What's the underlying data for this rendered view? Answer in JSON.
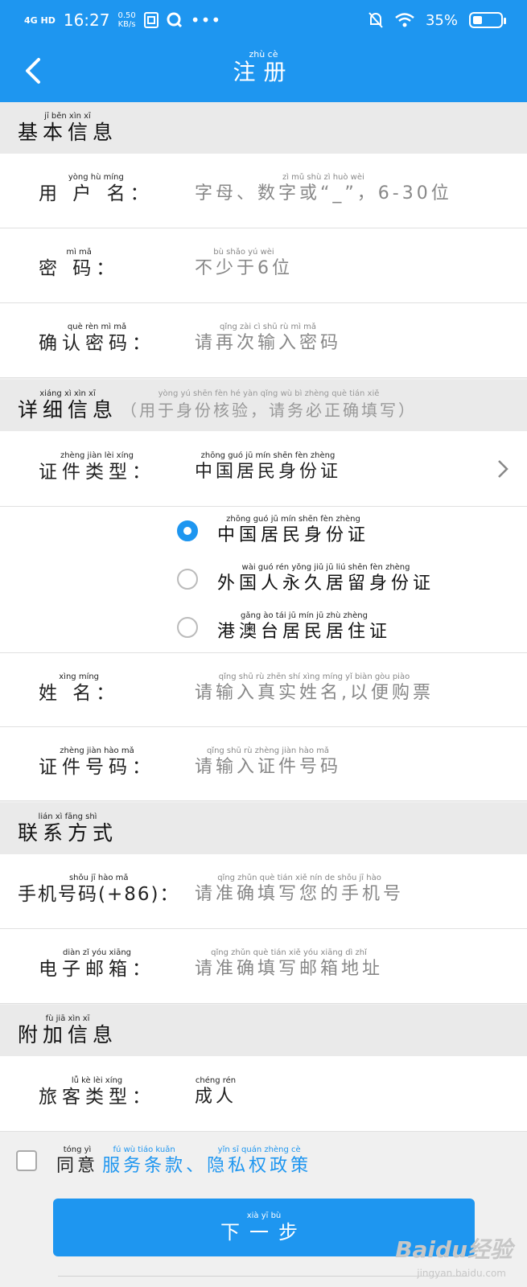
{
  "status_bar": {
    "network": "4G HD",
    "time": "16:27",
    "speed_value": "0.50",
    "speed_unit": "KB/s",
    "battery": "35%",
    "battery_level": 0.35,
    "icons": [
      "sd-card-icon",
      "search-app-icon",
      "more-dots-icon",
      "mute-bell-icon",
      "wifi-icon",
      "battery-icon"
    ]
  },
  "header": {
    "title": "注册",
    "title_pinyin": "zhù  cè",
    "back_icon": "chevron-left-icon"
  },
  "sections": {
    "basic": {
      "title": "基本信息",
      "pinyin": "jī   běn   xìn   xī"
    },
    "detail": {
      "title": "详细信息",
      "pinyin": "xiáng  xì   xìn   xī",
      "note": "（用于身份核验，请务必正确填写）",
      "note_pinyin": "yòng  yú  shēn  fèn   hé   yàn       qǐng  wù   bì  zhèng  què  tián  xiě"
    },
    "contact": {
      "title": "联系方式",
      "pinyin": "lián   xì  fāng  shì"
    },
    "extra": {
      "title": "附加信息",
      "pinyin": "fù   jiā   xìn   xī"
    }
  },
  "fields": {
    "username": {
      "label": "用 户 名：",
      "label_pinyin": "yòng    hù    míng",
      "placeholder": "字母、数字或“_”，6-30位",
      "placeholder_pinyin": "zì  mǔ      shù  zì  huò                          wèi"
    },
    "password": {
      "label": "密      码：",
      "label_pinyin": "mì              mǎ",
      "placeholder": "不少于6位",
      "placeholder_pinyin": "bù  shǎo  yú      wèi"
    },
    "confirm": {
      "label": "确认密码：",
      "label_pinyin": "què  rèn   mì   mǎ",
      "placeholder": "请再次输入密码",
      "placeholder_pinyin": "qǐng  zài   cì   shū   rù   mì   mǎ"
    },
    "id_type": {
      "label": "证件类型：",
      "label_pinyin": "zhèng  jiàn  lèi  xíng",
      "value": "中国居民身份证",
      "value_pinyin": "zhōng guó  jū  mín shēn fèn zhèng"
    },
    "name": {
      "label": "姓      名：",
      "label_pinyin": "xìng            míng",
      "placeholder": "请输入真实姓名,以便购票",
      "placeholder_pinyin": "qǐng shū  rù zhēn shí xìng míng   yǐ  biàn gòu piào"
    },
    "id_number": {
      "label": "证件号码：",
      "label_pinyin": "zhèng  jiàn  hào   mǎ",
      "placeholder": "请输入证件号码",
      "placeholder_pinyin": "qǐng  shū  rù zhèng jiàn hào  mǎ"
    },
    "phone": {
      "label": "手机号码(+86)：",
      "label_pinyin": "shǒu   jī   hào   mǎ",
      "placeholder": "请准确填写您的手机号",
      "placeholder_pinyin": "qǐng zhǔn què tián xiě  nín  de  shǒu  jī  hào"
    },
    "email": {
      "label": "电子邮箱：",
      "label_pinyin": "diàn   zǐ   yóu xiāng",
      "placeholder": "请准确填写邮箱地址",
      "placeholder_pinyin": "qǐng zhǔn què tián xiě yóu xiāng dì  zhǐ"
    },
    "passenger_type": {
      "label": "旅客类型：",
      "label_pinyin": "lǚ    kè   lèi  xíng",
      "value": "成人",
      "value_pinyin": "chéng  rén"
    }
  },
  "id_options": [
    {
      "label": "中国居民身份证",
      "pinyin": "zhōng guó  jū  mín shēn fèn zhèng",
      "selected": true
    },
    {
      "label": "外国人永久居留身份证",
      "pinyin": "wài guó rén yǒng jiǔ  jū  liú shēn fèn zhèng",
      "selected": false
    },
    {
      "label": "港澳台居民居住证",
      "pinyin": "gǎng  ào  tái  jū  mín  jū  zhù zhèng",
      "selected": false
    }
  ],
  "agree": {
    "prefix": "同意",
    "prefix_pinyin": "tóng  yì",
    "terms": "服务条款",
    "terms_pinyin": "fú  wù  tiáo kuǎn",
    "separator": "、",
    "privacy": "隐私权政策",
    "privacy_pinyin": "yǐn  sī  quán zhèng cè",
    "checked": false
  },
  "next_button": {
    "label": "下一步",
    "pinyin": "xià   yī   bù"
  },
  "watermark": {
    "text": "Baidu经验",
    "sub": "jingyan.baidu.com"
  }
}
